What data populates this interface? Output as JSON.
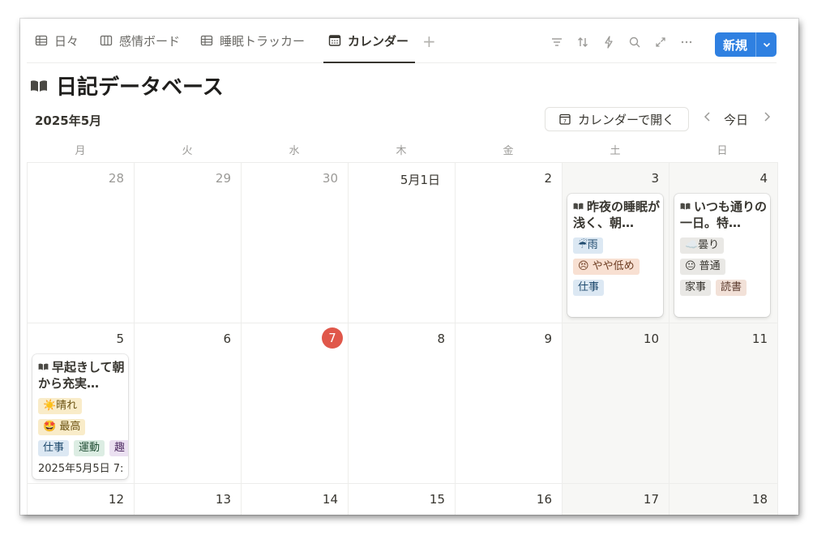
{
  "tabs": [
    {
      "label": "日々",
      "icon": "table-icon"
    },
    {
      "label": "感情ボード",
      "icon": "board-icon"
    },
    {
      "label": "睡眠トラッカー",
      "icon": "table-icon"
    },
    {
      "label": "カレンダー",
      "icon": "calendar-icon",
      "active": true
    }
  ],
  "toolbar": {
    "new_label": "新規",
    "icons": [
      "filter-icon",
      "sort-icon",
      "automation-icon",
      "search-icon",
      "expand-icon",
      "more-icon"
    ]
  },
  "page": {
    "title": "日記データベース",
    "icon": "book-icon"
  },
  "calendar": {
    "month": "2025年5月",
    "open_label": "カレンダーで開く",
    "today_label": "今日",
    "weekdays": [
      "月",
      "火",
      "水",
      "木",
      "金",
      "土",
      "日"
    ],
    "rows": [
      [
        "28",
        "29",
        "30",
        "5月1日",
        "2",
        "3",
        "4"
      ],
      [
        "5",
        "6",
        "7",
        "8",
        "9",
        "10",
        "11"
      ],
      [
        "12",
        "13",
        "14",
        "15",
        "16",
        "17",
        "18"
      ]
    ],
    "today": "7"
  },
  "cards": {
    "may3": {
      "title": "昨夜の睡眠が浅く、朝…",
      "weather": "☔雨",
      "mood": "😣 やや低め",
      "tag": "仕事"
    },
    "may4": {
      "title": "いつも通りの一日。特…",
      "weather": "☁️曇り",
      "mood": "😐 普通",
      "tags": [
        "家事",
        "読書"
      ]
    },
    "may5": {
      "title": "早起きして朝から充実…",
      "weather": "☀️晴れ",
      "mood": "🤩 最高",
      "tags": [
        "仕事",
        "運動",
        "趣"
      ],
      "date": "2025年5月5日 7:"
    }
  }
}
